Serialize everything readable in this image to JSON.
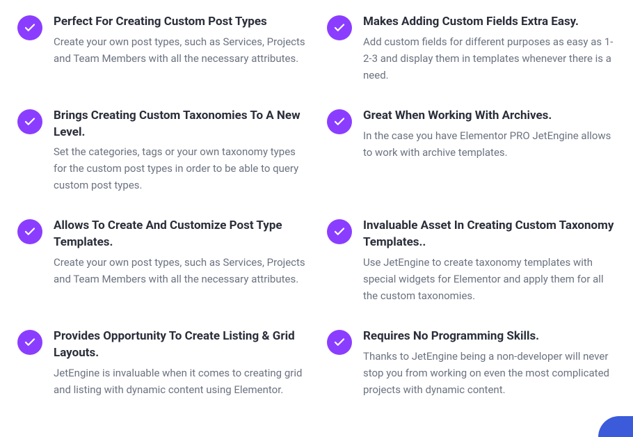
{
  "features": [
    {
      "title": "Perfect For Creating Custom Post Types",
      "description": "Create your own post types, such as Services, Projects and Team Members with all the necessary attributes."
    },
    {
      "title": "Makes Adding Custom Fields Extra Easy.",
      "description": "Add custom fields for different purposes as easy as 1-2-3 and display them in templates whenever there is a need."
    },
    {
      "title": "Brings Creating Custom Taxonomies To A New Level.",
      "description": "Set the categories, tags or your own taxonomy types for the custom post types in order to be able to query custom post types."
    },
    {
      "title": "Great When Working With Archives.",
      "description": "In the case you have Elementor PRO JetEngine allows to work with archive templates."
    },
    {
      "title": "Allows To Create And Customize Post Type Templates.",
      "description": "Create your own post types, such as Services, Projects and Team Members with all the necessary attributes."
    },
    {
      "title": "Invaluable Asset In Creating Custom Taxonomy Templates..",
      "description": "Use JetEngine to create taxonomy templates with special widgets for Elementor and apply them for all the custom taxonomies."
    },
    {
      "title": "Provides Opportunity To Create Listing & Grid Layouts.",
      "description": "JetEngine is invaluable when it comes to creating grid and listing with dynamic content using Elementor."
    },
    {
      "title": "Requires No Programming Skills.",
      "description": "Thanks to JetEngine being a non-developer will never stop you from working on even the most complicated projects with dynamic content."
    }
  ],
  "colors": {
    "iconBg": "#8b3dff",
    "titleColor": "#2a2e3a",
    "descColor": "#6b7280",
    "badgeBg": "#3b5bdb"
  }
}
